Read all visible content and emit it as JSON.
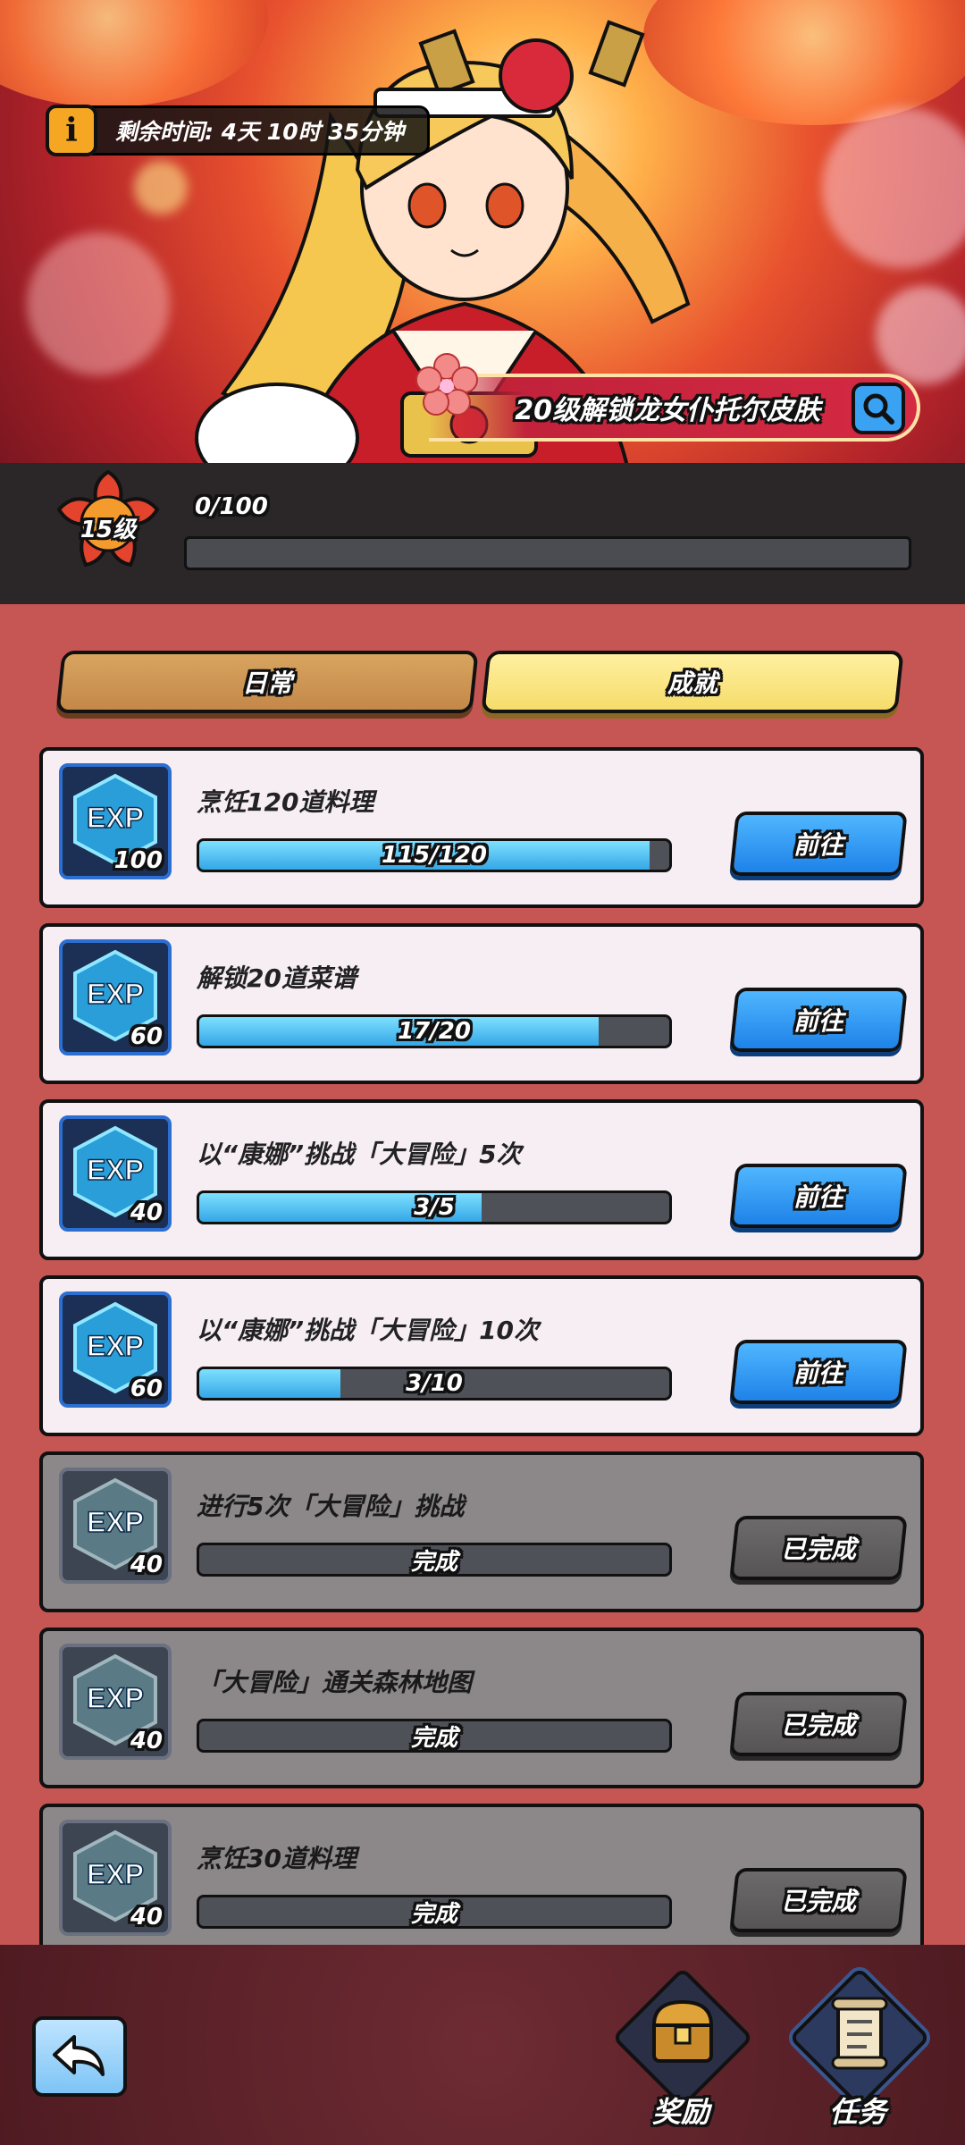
{
  "header": {
    "timer_text": "剩余时间: 4天 10时 35分钟",
    "info_icon": "i",
    "skin_banner": "20级解锁龙女仆托尔皮肤"
  },
  "level": {
    "label": "15级",
    "xp_text": "0/100",
    "xp_progress": 0
  },
  "tabs": [
    {
      "label": "日常",
      "selected": false
    },
    {
      "label": "成就",
      "selected": true
    }
  ],
  "tasks": [
    {
      "title": "烹饪120道料理",
      "exp_label": "EXP",
      "exp": "100",
      "progress_text": "115/120",
      "progress": 0.958,
      "button": "前往",
      "done": false
    },
    {
      "title": "解锁20道菜谱",
      "exp_label": "EXP",
      "exp": "60",
      "progress_text": "17/20",
      "progress": 0.85,
      "button": "前往",
      "done": false
    },
    {
      "title": "以“康娜”挑战「大冒险」5次",
      "exp_label": "EXP",
      "exp": "40",
      "progress_text": "3/5",
      "progress": 0.6,
      "button": "前往",
      "done": false
    },
    {
      "title": "以“康娜”挑战「大冒险」10次",
      "exp_label": "EXP",
      "exp": "60",
      "progress_text": "3/10",
      "progress": 0.3,
      "button": "前往",
      "done": false
    },
    {
      "title": "进行5次「大冒险」挑战",
      "exp_label": "EXP",
      "exp": "40",
      "progress_text": "完成",
      "progress": 1,
      "button": "已完成",
      "done": true
    },
    {
      "title": "「大冒险」通关森林地图",
      "exp_label": "EXP",
      "exp": "40",
      "progress_text": "完成",
      "progress": 1,
      "button": "已完成",
      "done": true
    },
    {
      "title": "烹饪30道料理",
      "exp_label": "EXP",
      "exp": "40",
      "progress_text": "完成",
      "progress": 1,
      "button": "已完成",
      "done": true
    }
  ],
  "bottom_nav": {
    "back_icon": "back-arrow-icon",
    "items": [
      {
        "label": "奖励",
        "icon": "treasure-chest-icon",
        "active": false
      },
      {
        "label": "任务",
        "icon": "scroll-icon",
        "active": true
      }
    ]
  },
  "colors": {
    "accent_blue": "#1e82e8",
    "progress_cyan": "#34a7e6",
    "tab_selected": "#f5dc6a",
    "tab_unselected": "#c48848",
    "background": "#c65654"
  }
}
